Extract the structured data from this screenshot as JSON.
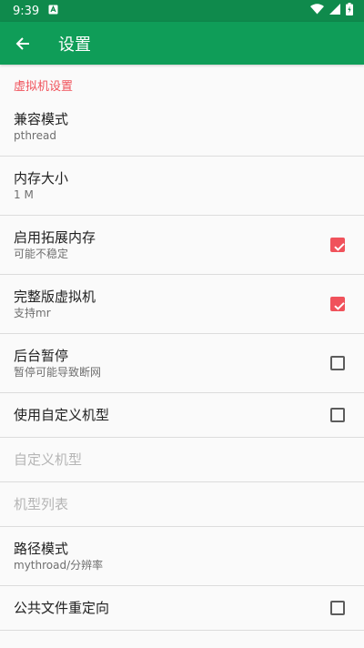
{
  "status": {
    "time": "9:39",
    "color": "#0f8a4c"
  },
  "toolbar": {
    "title": "设置",
    "color": "#0f9d58"
  },
  "accent": "#f0525b",
  "section": {
    "header": "虚拟机设置"
  },
  "items": [
    {
      "title": "兼容模式",
      "summary": "pthread",
      "checkbox": null
    },
    {
      "title": "内存大小",
      "summary": "1 M",
      "checkbox": null
    },
    {
      "title": "启用拓展内存",
      "summary": "可能不稳定",
      "checkbox": true
    },
    {
      "title": "完整版虚拟机",
      "summary": "支持mr",
      "checkbox": true
    },
    {
      "title": "后台暂停",
      "summary": "暂停可能导致断网",
      "checkbox": false
    },
    {
      "title": "使用自定义机型",
      "summary": "",
      "checkbox": false
    },
    {
      "title": "自定义机型",
      "summary": "",
      "checkbox": null,
      "disabled": true
    },
    {
      "title": "机型列表",
      "summary": "",
      "checkbox": null,
      "disabled": true
    },
    {
      "title": "路径模式",
      "summary": "mythroad/分辨率",
      "checkbox": null
    },
    {
      "title": "公共文件重定向",
      "summary": "",
      "checkbox": false
    }
  ]
}
